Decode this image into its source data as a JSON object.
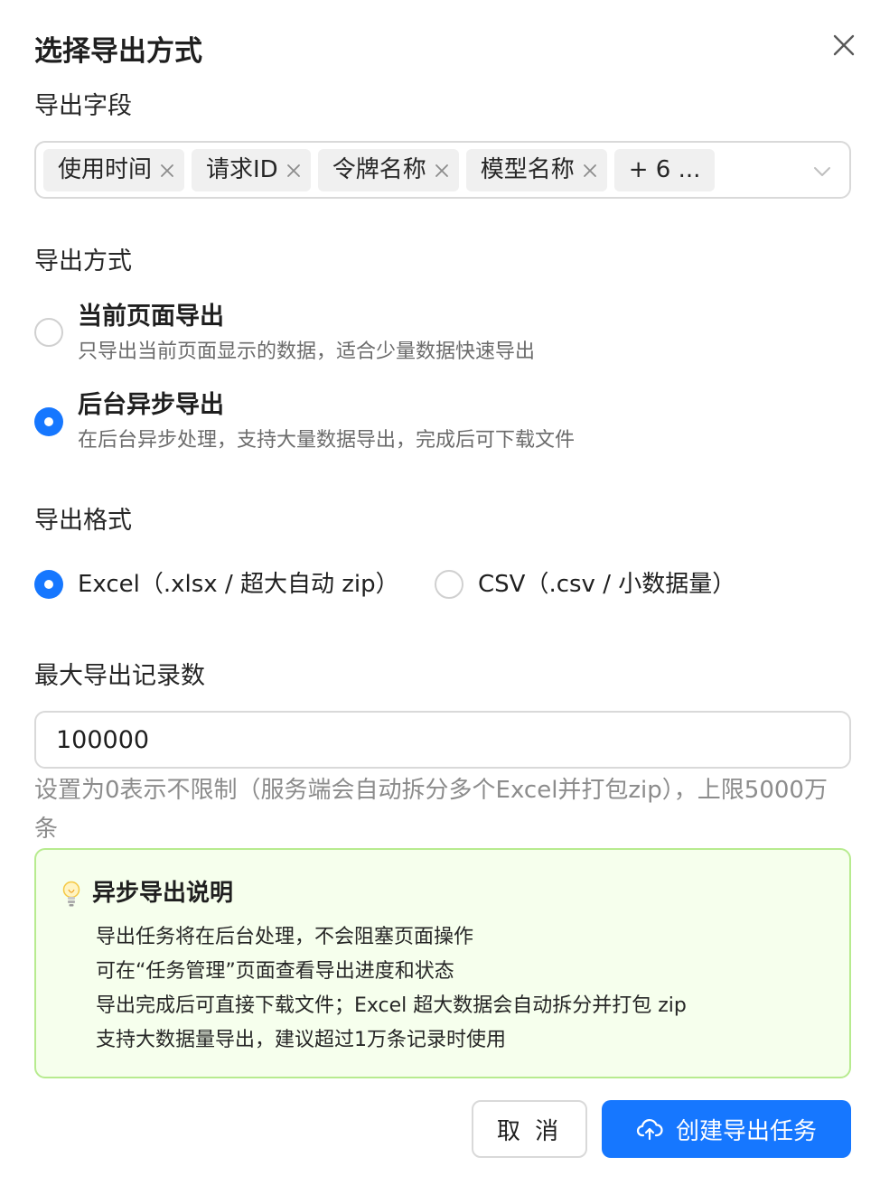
{
  "dialog": {
    "title": "选择导出方式"
  },
  "fields": {
    "label": "导出字段",
    "tags": [
      "使用时间",
      "请求ID",
      "令牌名称",
      "模型名称"
    ],
    "more": "+ 6 ..."
  },
  "mode": {
    "label": "导出方式",
    "options": [
      {
        "title": "当前页面导出",
        "desc": "只导出当前页面显示的数据，适合少量数据快速导出",
        "checked": false
      },
      {
        "title": "后台异步导出",
        "desc": "在后台异步处理，支持大量数据导出，完成后可下载文件",
        "checked": true
      }
    ]
  },
  "format": {
    "label": "导出格式",
    "options": [
      {
        "label": "Excel（.xlsx / 超大自动 zip）",
        "checked": true
      },
      {
        "label": "CSV（.csv / 小数据量）",
        "checked": false
      }
    ]
  },
  "max_records": {
    "label": "最大导出记录数",
    "value": "100000",
    "hint": "设置为0表示不限制（服务端会自动拆分多个Excel并打包zip），上限5000万条"
  },
  "info": {
    "icon": "lightbulb-icon",
    "title": "异步导出说明",
    "items": [
      "导出任务将在后台处理，不会阻塞页面操作",
      "可在“任务管理”页面查看导出进度和状态",
      "导出完成后可直接下载文件；Excel 超大数据会自动拆分并打包 zip",
      "支持大数据量导出，建议超过1万条记录时使用"
    ]
  },
  "buttons": {
    "cancel": "取 消",
    "create": "创建导出任务"
  },
  "colors": {
    "primary": "#1677ff",
    "info_bg": "#f6ffed",
    "info_border": "#b7eb8f"
  }
}
